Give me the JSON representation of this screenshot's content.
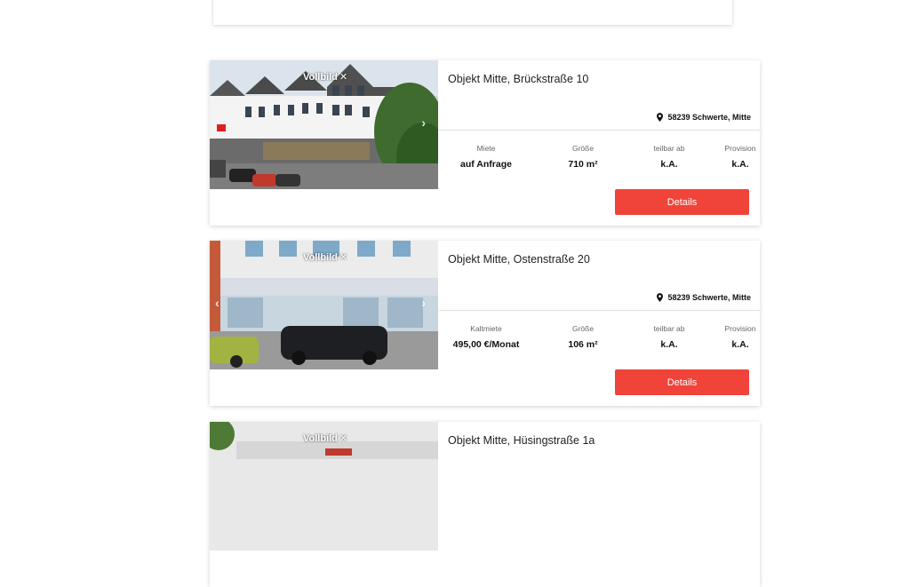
{
  "listings": [
    {
      "photo_badge": "Vollbild",
      "title": "Objekt Mitte, Brückstraße 10",
      "location": "58239 Schwerte, Mitte",
      "stats": [
        {
          "label": "Miete",
          "value": "auf Anfrage"
        },
        {
          "label": "Größe",
          "value": "710 m²"
        },
        {
          "label": "teilbar ab",
          "value": "k.A."
        },
        {
          "label": "Provision",
          "value": "k.A."
        }
      ],
      "button_label": "Details"
    },
    {
      "photo_badge": "Vollbild",
      "title": "Objekt Mitte, Ostenstraße 20",
      "location": "58239 Schwerte, Mitte",
      "stats": [
        {
          "label": "Kaltmiete",
          "value": "495,00 €/Monat"
        },
        {
          "label": "Größe",
          "value": "106 m²"
        },
        {
          "label": "teilbar ab",
          "value": "k.A."
        },
        {
          "label": "Provision",
          "value": "k.A."
        }
      ],
      "button_label": "Details"
    },
    {
      "photo_badge": "Vollbild",
      "title": "Objekt Mitte, Hüsingstraße 1a"
    }
  ],
  "icons": {
    "location": "map-pin-icon",
    "fullscreen": "expand-icon",
    "next": "chevron-right-icon",
    "prev": "chevron-left-icon"
  },
  "colors": {
    "button": "#f0443a",
    "button_text": "#ffffff"
  }
}
